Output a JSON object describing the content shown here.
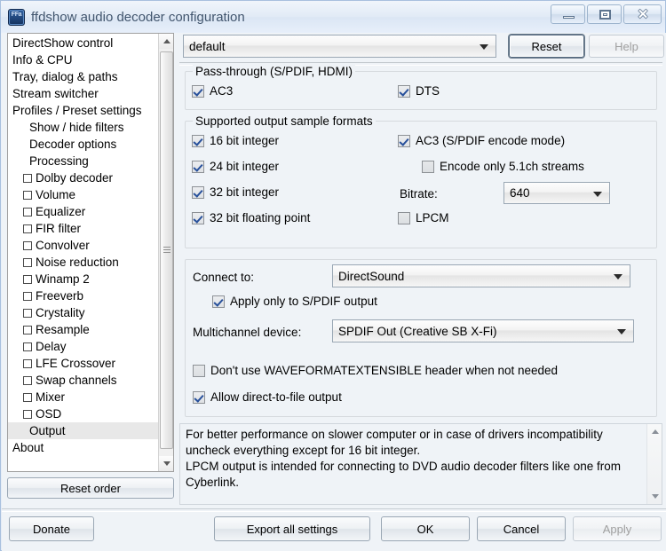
{
  "window": {
    "title": "ffdshow audio decoder configuration",
    "icon": "ffdshow-app-icon",
    "caption_buttons": {
      "minimize": "minimize-icon",
      "maximize": "maximize-icon",
      "close": "close-icon"
    }
  },
  "sidebar": {
    "items": [
      {
        "label": "DirectShow control",
        "indent": 0,
        "checkbox": false
      },
      {
        "label": "Info & CPU",
        "indent": 0,
        "checkbox": false
      },
      {
        "label": "Tray, dialog & paths",
        "indent": 0,
        "checkbox": false
      },
      {
        "label": "Stream switcher",
        "indent": 0,
        "checkbox": false
      },
      {
        "label": "Profiles / Preset settings",
        "indent": 0,
        "checkbox": false
      },
      {
        "label": "Show / hide filters",
        "indent": 1,
        "checkbox": false
      },
      {
        "label": "Decoder options",
        "indent": 1,
        "checkbox": false
      },
      {
        "label": "Processing",
        "indent": 1,
        "checkbox": false
      },
      {
        "label": "Dolby decoder",
        "indent": 0,
        "checkbox": true,
        "checked": false
      },
      {
        "label": "Volume",
        "indent": 0,
        "checkbox": true,
        "checked": false
      },
      {
        "label": "Equalizer",
        "indent": 0,
        "checkbox": true,
        "checked": false
      },
      {
        "label": "FIR filter",
        "indent": 0,
        "checkbox": true,
        "checked": false
      },
      {
        "label": "Convolver",
        "indent": 0,
        "checkbox": true,
        "checked": false
      },
      {
        "label": "Noise reduction",
        "indent": 0,
        "checkbox": true,
        "checked": false
      },
      {
        "label": "Winamp 2",
        "indent": 0,
        "checkbox": true,
        "checked": false
      },
      {
        "label": "Freeverb",
        "indent": 0,
        "checkbox": true,
        "checked": false
      },
      {
        "label": "Crystality",
        "indent": 0,
        "checkbox": true,
        "checked": false
      },
      {
        "label": "Resample",
        "indent": 0,
        "checkbox": true,
        "checked": false
      },
      {
        "label": "Delay",
        "indent": 0,
        "checkbox": true,
        "checked": false
      },
      {
        "label": "LFE Crossover",
        "indent": 0,
        "checkbox": true,
        "checked": false
      },
      {
        "label": "Swap channels",
        "indent": 0,
        "checkbox": true,
        "checked": false
      },
      {
        "label": "Mixer",
        "indent": 0,
        "checkbox": true,
        "checked": false
      },
      {
        "label": "OSD",
        "indent": 0,
        "checkbox": true,
        "checked": false
      },
      {
        "label": "Output",
        "indent": 1,
        "checkbox": false,
        "selected": true
      },
      {
        "label": "About",
        "indent": 0,
        "checkbox": false
      }
    ],
    "reset_order_label": "Reset order"
  },
  "toolbar": {
    "profile_value": "default",
    "reset_label": "Reset",
    "help_label": "Help",
    "help_disabled": true
  },
  "passthrough": {
    "legend": "Pass-through (S/PDIF, HDMI)",
    "ac3": {
      "label": "AC3",
      "checked": true
    },
    "dts": {
      "label": "DTS",
      "checked": true
    }
  },
  "sample_formats": {
    "legend": "Supported output sample formats",
    "int16": {
      "label": "16 bit integer",
      "checked": true
    },
    "int24": {
      "label": "24 bit integer",
      "checked": true
    },
    "int32": {
      "label": "32 bit integer",
      "checked": true
    },
    "float32": {
      "label": "32 bit floating point",
      "checked": true
    },
    "ac3_spdif": {
      "label": "AC3 (S/PDIF encode mode)",
      "checked": true
    },
    "encode_only_51": {
      "label": "Encode only 5.1ch streams",
      "checked": false
    },
    "bitrate_label": "Bitrate:",
    "bitrate_value": "640",
    "lpcm": {
      "label": "LPCM",
      "checked": false
    }
  },
  "connection": {
    "connect_to_label": "Connect to:",
    "connect_to_value": "DirectSound",
    "apply_spdif": {
      "label": "Apply only to S/PDIF output",
      "checked": true
    },
    "multichannel_label": "Multichannel device:",
    "multichannel_value": "SPDIF Out (Creative SB X-Fi)",
    "no_waveformatextensible": {
      "label": "Don't use WAVEFORMATEXTENSIBLE header when not needed",
      "checked": false
    },
    "direct_to_file": {
      "label": "Allow direct-to-file output",
      "checked": true
    }
  },
  "info": {
    "text": "For better performance on slower computer or in case of drivers incompatibility uncheck everything except for 16 bit integer.\nLPCM output is intended for connecting to DVD audio decoder filters like one from Cyberlink."
  },
  "footer": {
    "donate": "Donate",
    "export": "Export all settings",
    "ok": "OK",
    "cancel": "Cancel",
    "apply": "Apply",
    "apply_disabled": true
  },
  "colors": {
    "accent_check": "#27509b",
    "title_text": "#42566e",
    "window_bg": "#eff3f7"
  }
}
